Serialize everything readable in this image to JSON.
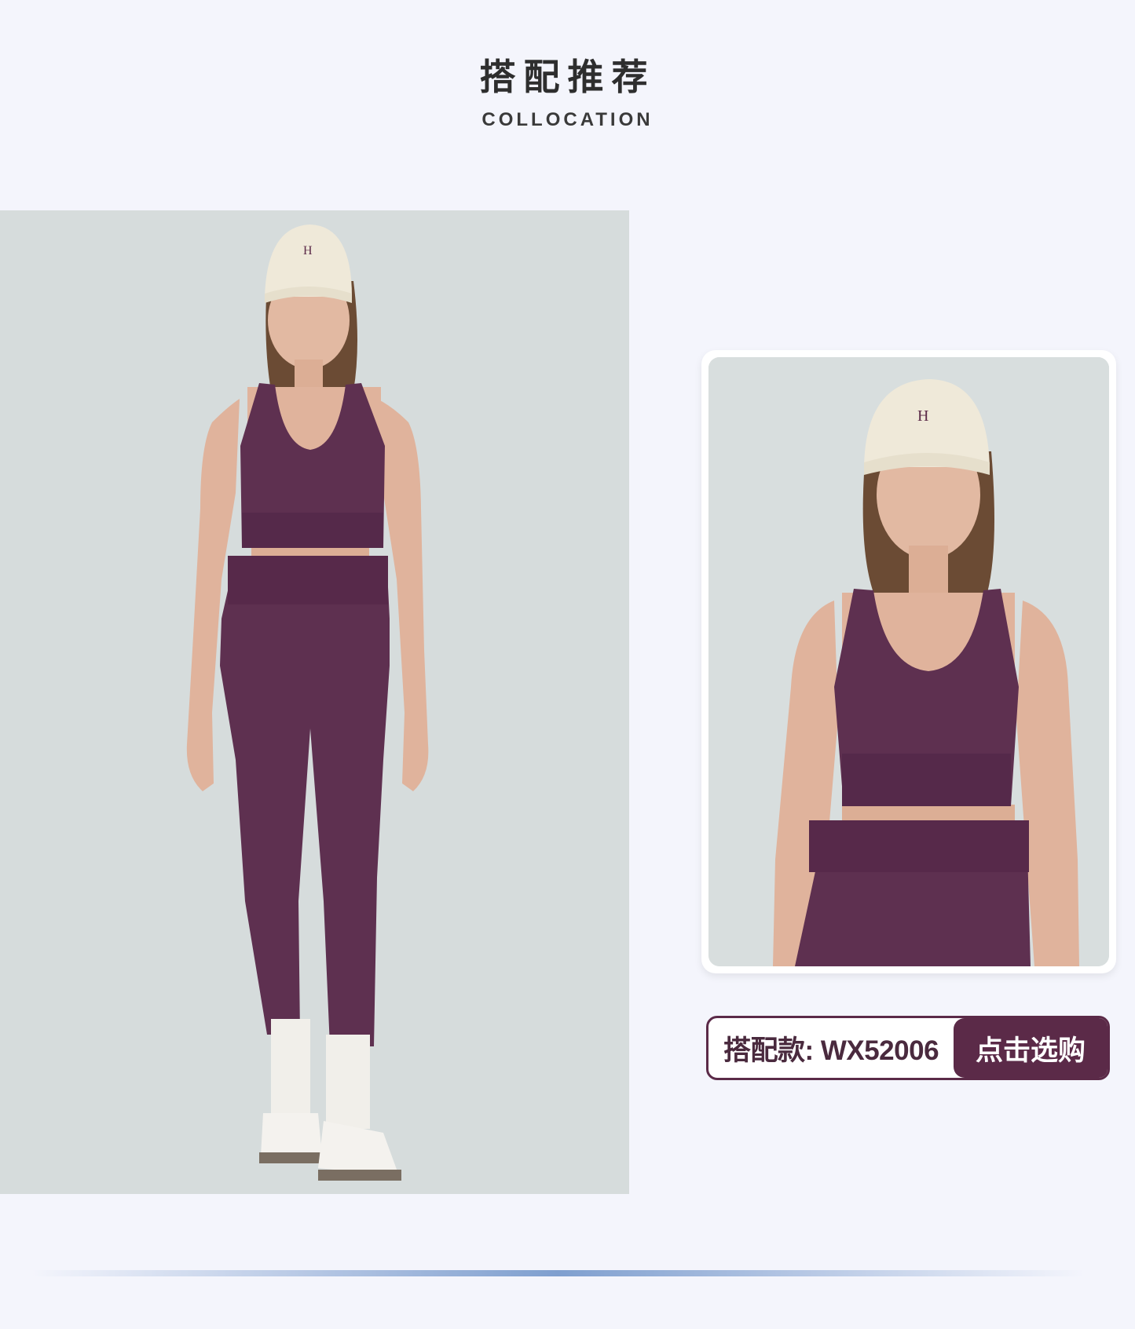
{
  "header": {
    "title": "搭配推荐",
    "subtitle": "COLLOCATION"
  },
  "images": {
    "main_photo": "full-body-model-photo",
    "detail_photo": "upper-body-model-photo"
  },
  "cta": {
    "code_label": "搭配款: WX52006",
    "button_label": "点击选购"
  },
  "colors": {
    "background": "#f4f5fc",
    "accent": "#5b2a48",
    "garment": "#5e3050",
    "photo_bg": "#d6dcdc",
    "divider": "#7f9fcf"
  }
}
